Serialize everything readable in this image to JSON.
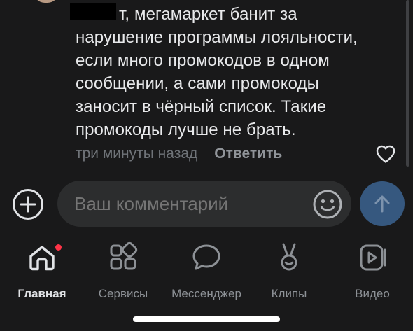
{
  "comment": {
    "text_first_line": "т, мегамаркет банит за",
    "text_rest": [
      "нарушение программы лояльности,",
      "если много промокодов в одном",
      "сообщении, а сами промокоды",
      "заносит в чёрный список. Такие",
      "промокоды лучше не брать."
    ],
    "timestamp": "три минуты назад",
    "reply_label": "Ответить"
  },
  "composer": {
    "placeholder": "Ваш комментарий",
    "attach_icon": "plus-circle-icon",
    "emoji_icon": "smile-icon",
    "send_icon": "arrow-up-icon",
    "send_color": "#36587f"
  },
  "tabbar": {
    "tabs": [
      {
        "label": "Главная",
        "icon": "home-icon",
        "active": true,
        "badge": true
      },
      {
        "label": "Сервисы",
        "icon": "services-icon",
        "active": false
      },
      {
        "label": "Мессенджер",
        "icon": "chat-bubble-icon",
        "active": false
      },
      {
        "label": "Клипы",
        "icon": "clips-icon",
        "active": false
      },
      {
        "label": "Видео",
        "icon": "video-icon",
        "active": false
      }
    ],
    "badge_color": "#ff3347"
  },
  "colors": {
    "background": "#19191a",
    "text_primary": "#e8e9eb",
    "text_secondary": "#8d9196",
    "input_background": "#2c2d2e"
  }
}
